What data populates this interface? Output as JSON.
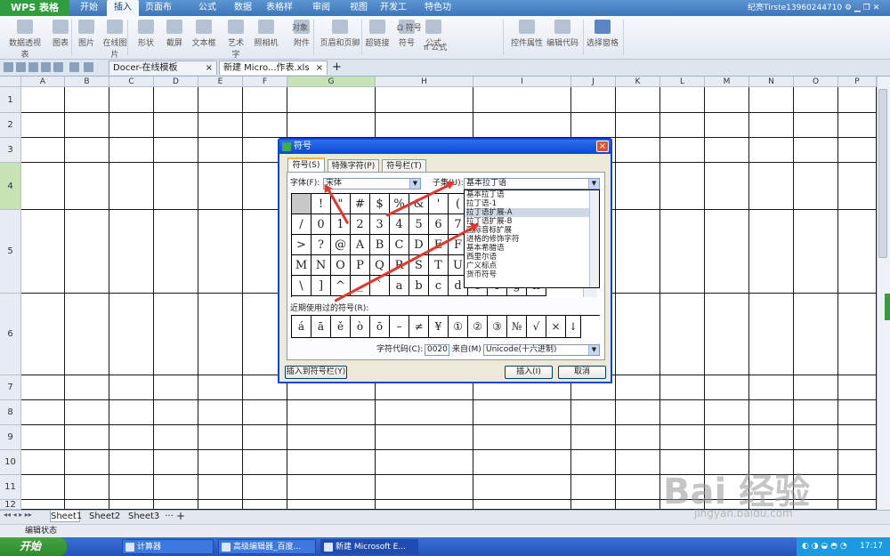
{
  "app": {
    "name": "WPS 表格",
    "menus": [
      "开始",
      "插入",
      "页面布局",
      "公式",
      "数据",
      "表格样式",
      "审阅",
      "视图",
      "开发工具",
      "特色功能"
    ],
    "active_menu": 1,
    "user": "纪亮Tirste13960244710"
  },
  "ribbon": {
    "buttons": [
      "数据透视表",
      "图表",
      "图片",
      "在线图片",
      "形状",
      "截屏",
      "文本框",
      "艺术字",
      "照相机",
      "附件",
      "页眉和页脚",
      "超链接",
      "符号",
      "公式",
      "控件属性",
      "编辑代码",
      "选择窗格"
    ],
    "small": [
      "对象",
      "Ω 符号",
      "π 公式"
    ]
  },
  "tabs": {
    "docs": [
      "Docer-在线模板",
      "新建 Micro...作表.xls"
    ],
    "add": "+"
  },
  "sheet": {
    "columns": [
      "A",
      "B",
      "C",
      "D",
      "E",
      "F",
      "G",
      "H",
      "I",
      "J",
      "K",
      "L",
      "M",
      "N",
      "O",
      "P"
    ],
    "rows": [
      "1",
      "2",
      "3",
      "4",
      "5",
      "6",
      "7",
      "8",
      "9",
      "10",
      "11",
      "12"
    ],
    "selected_column": "G",
    "selected_row": "4"
  },
  "sheettabs": [
    "Sheet1",
    "Sheet2",
    "Sheet3"
  ],
  "sheettab_more": "···",
  "status": "编辑状态",
  "taskbar": {
    "start": "开始",
    "tasks": [
      "计算器",
      "高级编辑器_百度...",
      "新建 Microsoft E..."
    ],
    "time": "17:17"
  },
  "dialog": {
    "title": "符号",
    "close": "×",
    "tabs": [
      "符号(S)",
      "特殊字符(P)",
      "符号栏(T)"
    ],
    "font_label": "字体(F):",
    "font_value": "宋体",
    "subset_label": "子集(U):",
    "subset_value": "基本拉丁语",
    "subset_options": [
      "基本拉丁语",
      "拉丁语-1",
      "拉丁语扩展-A",
      "拉丁语扩展-B",
      "国际音标扩展",
      "进格的修饰字符",
      "基本希腊语",
      "西里尔语",
      "广义标点",
      "货币符号"
    ],
    "subset_highlight": 2,
    "symbols": [
      [
        "",
        "!",
        "\"",
        "#",
        "$",
        "%",
        "&",
        "'",
        "(",
        ")",
        "*",
        "+",
        "-"
      ],
      [
        "/",
        "0",
        "1",
        "2",
        "3",
        "4",
        "5",
        "6",
        "7",
        "8",
        "9",
        ":",
        ";"
      ],
      [
        ">",
        "?",
        "@",
        "A",
        "B",
        "C",
        "D",
        "E",
        "F",
        "G",
        "H",
        "I",
        "J"
      ],
      [
        "M",
        "N",
        "O",
        "P",
        "Q",
        "R",
        "S",
        "T",
        "U",
        "V",
        "W",
        "X",
        "Y"
      ],
      [
        "\\",
        "]",
        "^",
        "_",
        "`",
        "a",
        "b",
        "c",
        "d",
        "e",
        "f",
        "g",
        "h"
      ]
    ],
    "recent_label": "近期使用过的符号(R):",
    "recent": [
      "á",
      "ā",
      "ě",
      "ò",
      "ō",
      "–",
      "≠",
      "¥",
      "①",
      "②",
      "③",
      "№",
      "√",
      "×",
      "↓"
    ],
    "code_label": "字符代码(C):",
    "code_value": "0020",
    "from_label": "来自(M)",
    "from_value": "Unicode(十六进制)",
    "insert_bar": "插入到符号栏(Y)",
    "insert": "插入(I)",
    "cancel": "取消"
  },
  "watermark": "Bai 经验",
  "watermark_sub": "jingyan.baidu.com"
}
